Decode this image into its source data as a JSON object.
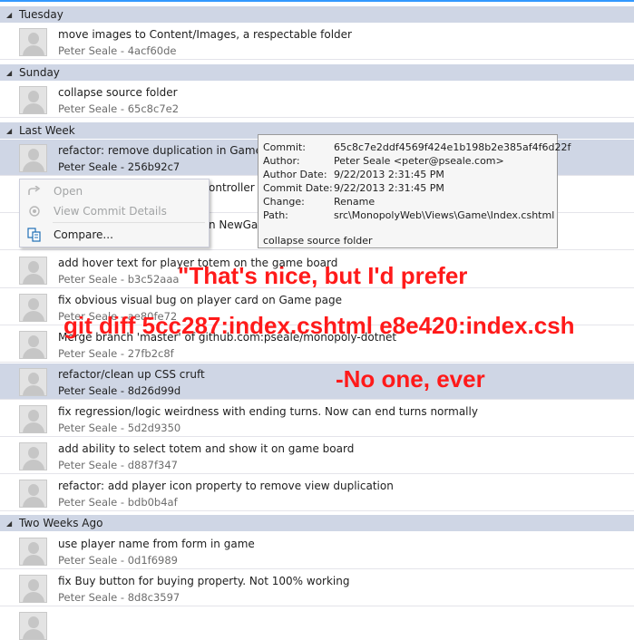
{
  "groups": [
    {
      "label": "Tuesday"
    },
    {
      "label": "Sunday"
    },
    {
      "label": "Last Week"
    },
    {
      "label": "Two Weeks Ago"
    }
  ],
  "commits": [
    {
      "message": "move images to Content/Images, a respectable folder",
      "meta": "Peter Seale - 4acf60de"
    },
    {
      "message": "collapse source folder",
      "meta": "Peter Seale - 65c8c7e2"
    },
    {
      "message": "refactor: remove duplication in GameCon",
      "meta": "Peter Seale - 256b92c7"
    },
    {
      "message": "ontroller a",
      "meta": ""
    },
    {
      "message": "n NewGam",
      "meta": ""
    },
    {
      "message": "add hover text for player totem on the game board",
      "meta": "Peter Seale - b3c52aaa"
    },
    {
      "message": "fix obvious visual bug on player card on Game page",
      "meta": "Peter Seale - ae80fe72"
    },
    {
      "message": "Merge branch 'master' of github.com:pseale/monopoly-dotnet",
      "meta": "Peter Seale - 27fb2c8f"
    },
    {
      "message": "refactor/clean up CSS cruft",
      "meta": "Peter Seale - 8d26d99d"
    },
    {
      "message": "fix regression/logic weirdness with ending turns. Now can end turns normally",
      "meta": "Peter Seale - 5d2d9350"
    },
    {
      "message": "add ability to select totem and show it on game board",
      "meta": "Peter Seale - d887f347"
    },
    {
      "message": "refactor: add player icon property to remove view duplication",
      "meta": "Peter Seale - bdb0b4af"
    },
    {
      "message": "use player name from form in game",
      "meta": "Peter Seale - 0d1f6989"
    },
    {
      "message": "fix Buy button for buying property. Not 100% working",
      "meta": "Peter Seale - 8d8c3597"
    }
  ],
  "context_menu": {
    "open": "Open",
    "view_details": "View Commit Details",
    "compare": "Compare..."
  },
  "tooltip": {
    "commit_label": "Commit:",
    "commit_value": "65c8c7e2ddf4569f424e1b198b2e385af4f6d22f",
    "author_label": "Author:",
    "author_value": "Peter Seale <peter@pseale.com>",
    "author_date_label": "Author Date:",
    "author_date_value": "9/22/2013 2:31:45 PM",
    "commit_date_label": "Commit Date:",
    "commit_date_value": "9/22/2013 2:31:45 PM",
    "change_label": "Change:",
    "change_value": "Rename",
    "path_label": "Path:",
    "path_value": "src\\MonopolyWeb\\Views\\Game\\Index.cshtml",
    "description": "collapse source folder"
  },
  "annotations": {
    "line1": "\"That's nice, but I'd prefer",
    "line2": "git diff 5cc287:index.cshtml e8e420:index.csh",
    "line3": "-No one, ever"
  },
  "colors": {
    "group_header": "#cfd6e5",
    "selected_row": "#cfd6e5",
    "annotation_red": "#ff1a1a",
    "accent": "#3399ff"
  }
}
